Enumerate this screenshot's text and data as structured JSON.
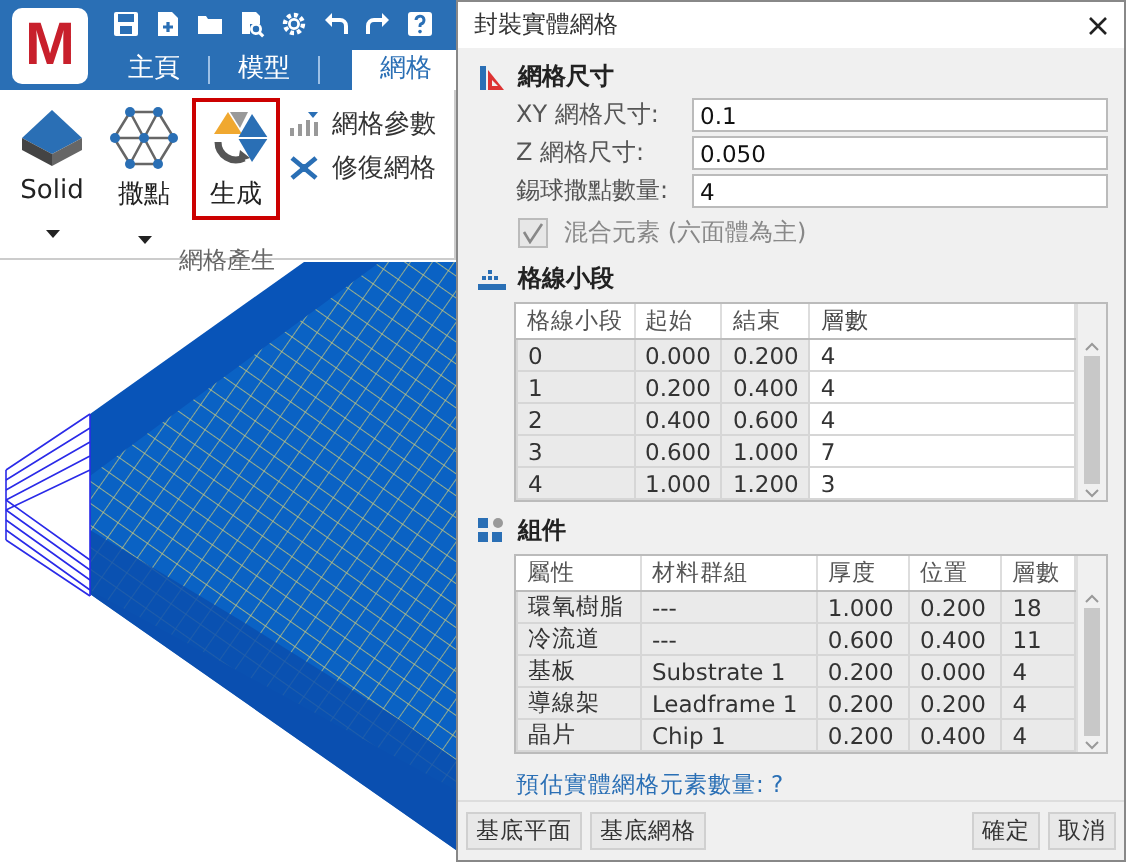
{
  "app": {
    "logo": "M",
    "ribbon_tabs": [
      {
        "label": "主頁",
        "selected": false
      },
      {
        "label": "模型",
        "selected": false
      },
      {
        "label": "網格",
        "selected": true
      }
    ],
    "ribbon_buttons": [
      {
        "label": "Solid",
        "kind": "dropdown",
        "highlighted": false
      },
      {
        "label": "撒點",
        "kind": "dropdown",
        "highlighted": false
      },
      {
        "label": "生成",
        "kind": "plain",
        "highlighted": true
      }
    ],
    "side_commands": [
      "網格參數",
      "修復網格"
    ],
    "group_label": "網格產生"
  },
  "dialog": {
    "title": "封裝實體網格",
    "mesh_size": {
      "heading": "網格尺寸",
      "fields": [
        {
          "label": "XY 網格尺寸:",
          "value": "0.1"
        },
        {
          "label": "Z 網格尺寸:",
          "value": "0.050"
        },
        {
          "label": "錫球撒點數量:",
          "value": "4"
        }
      ],
      "mixed_elements": {
        "label": "混合元素 (六面體為主)",
        "checked": true,
        "disabled": true
      }
    },
    "segments": {
      "heading": "格線小段",
      "columns": [
        {
          "label": "格線小段",
          "editable": false
        },
        {
          "label": "起始",
          "editable": false
        },
        {
          "label": "結束",
          "editable": false
        },
        {
          "label": "層數",
          "editable": true
        }
      ],
      "rows": [
        [
          "0",
          "0.000",
          "0.200",
          "4"
        ],
        [
          "1",
          "0.200",
          "0.400",
          "4"
        ],
        [
          "2",
          "0.400",
          "0.600",
          "4"
        ],
        [
          "3",
          "0.600",
          "1.000",
          "7"
        ],
        [
          "4",
          "1.000",
          "1.200",
          "3"
        ]
      ]
    },
    "components": {
      "heading": "組件",
      "columns": [
        {
          "label": "屬性",
          "editable": false
        },
        {
          "label": "材料群組",
          "editable": false
        },
        {
          "label": "厚度",
          "editable": false
        },
        {
          "label": "位置",
          "editable": false
        },
        {
          "label": "層數",
          "editable": false
        }
      ],
      "rows": [
        [
          "環氧樹脂",
          "---",
          "1.000",
          "0.200",
          "18"
        ],
        [
          "冷流道",
          "---",
          "0.600",
          "0.400",
          "11"
        ],
        [
          "基板",
          "Substrate 1",
          "0.200",
          "0.000",
          "4"
        ],
        [
          "導線架",
          "Leadframe 1",
          "0.200",
          "0.200",
          "4"
        ],
        [
          "晶片",
          "Chip 1",
          "0.200",
          "0.400",
          "4"
        ]
      ]
    },
    "estimate_link": "預估實體網格元素數量: ?",
    "left_buttons": [
      "基底平面",
      "基底網格"
    ],
    "right_buttons": [
      "確定",
      "取消"
    ]
  }
}
